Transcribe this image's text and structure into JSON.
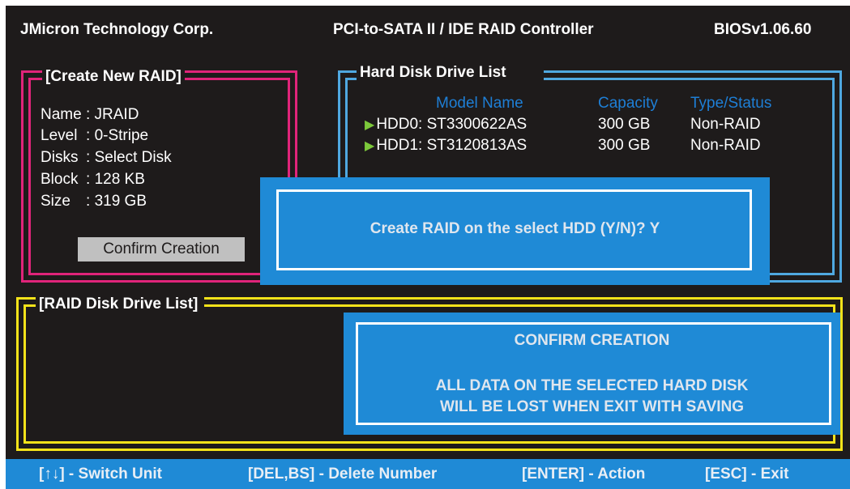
{
  "header": {
    "vendor": "JMicron Technology Corp.",
    "product": "PCI-to-SATA II / IDE RAID Controller",
    "bios": "BIOSv1.06.60"
  },
  "create_raid": {
    "title": "[Create New RAID]",
    "fields": [
      {
        "label": "Name",
        "value": "JRAID"
      },
      {
        "label": "Level",
        "value": "0-Stripe"
      },
      {
        "label": "Disks",
        "value": "Select Disk"
      },
      {
        "label": "Block",
        "value": "128 KB"
      },
      {
        "label": "Size",
        "value": "319 GB"
      }
    ],
    "confirm_button": "Confirm Creation"
  },
  "hdd_list": {
    "title": "Hard Disk Drive List",
    "columns": [
      "Model Name",
      "Capacity",
      "Type/Status"
    ],
    "rows": [
      {
        "model": "HDD0: ST3300622AS",
        "capacity": "300 GB",
        "status": "Non-RAID"
      },
      {
        "model": "HDD1: ST3120813AS",
        "capacity": "300 GB",
        "status": "Non-RAID"
      }
    ]
  },
  "raid_list": {
    "title": "[RAID Disk Drive List]"
  },
  "dialog_create": {
    "message": "Create RAID on the select HDD (Y/N)? Y"
  },
  "dialog_confirm": {
    "title": "CONFIRM CREATION",
    "warning_line1": "ALL DATA ON THE SELECTED HARD DISK",
    "warning_line2": "WILL BE LOST WHEN EXIT WITH SAVING"
  },
  "footer": {
    "switch_unit": "[↑↓] - Switch Unit",
    "delete_number": "[DEL,BS] - Delete Number",
    "action": "[ENTER] - Action",
    "exit": "[ESC] - Exit"
  },
  "colors": {
    "background": "#1e1b1b",
    "create_frame": "#e0247a",
    "hdd_frame": "#4fa8e0",
    "raid_frame": "#f5e31a",
    "dialog": "#1f8ad6",
    "column_header": "#1e7fd6",
    "arrow": "#7cc83a"
  },
  "icons": {
    "row_marker": "right-triangle-icon"
  }
}
